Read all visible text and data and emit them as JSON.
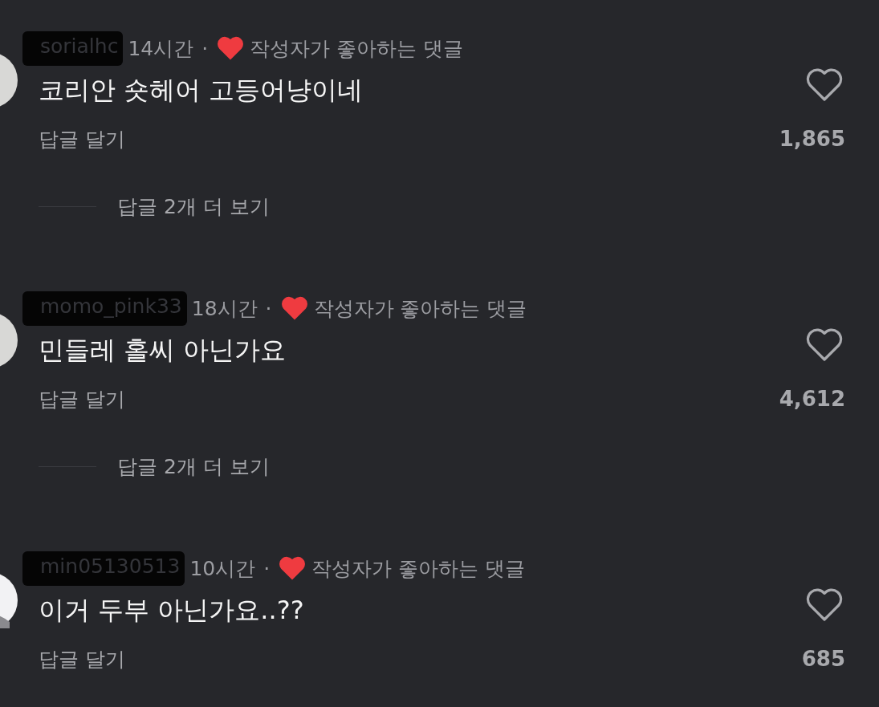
{
  "comments": [
    {
      "username": "sorialhc",
      "time": "14시간",
      "separator": "·",
      "author_liked": true,
      "author_liked_label": "작성자가 좋아하는 댓글",
      "text": "코리안 숏헤어 고등어냥이네",
      "reply_label": "답글 달기",
      "liked": false,
      "likes": "1,865",
      "more_replies": "답글 2개 더 보기"
    },
    {
      "username": "momo_pink33",
      "time": "18시간",
      "separator": "·",
      "author_liked": true,
      "author_liked_label": "작성자가 좋아하는 댓글",
      "text": "민들레 홀씨 아닌가요",
      "reply_label": "답글 달기",
      "liked": false,
      "likes": "4,612",
      "more_replies": "답글 2개 더 보기"
    },
    {
      "username": "min05130513",
      "time": "10시간",
      "separator": "·",
      "author_liked": true,
      "author_liked_label": "작성자가 좋아하는 댓글",
      "text": "이거 두부 아닌가요..??",
      "reply_label": "답글 달기",
      "liked": false,
      "likes": "685"
    }
  ]
}
